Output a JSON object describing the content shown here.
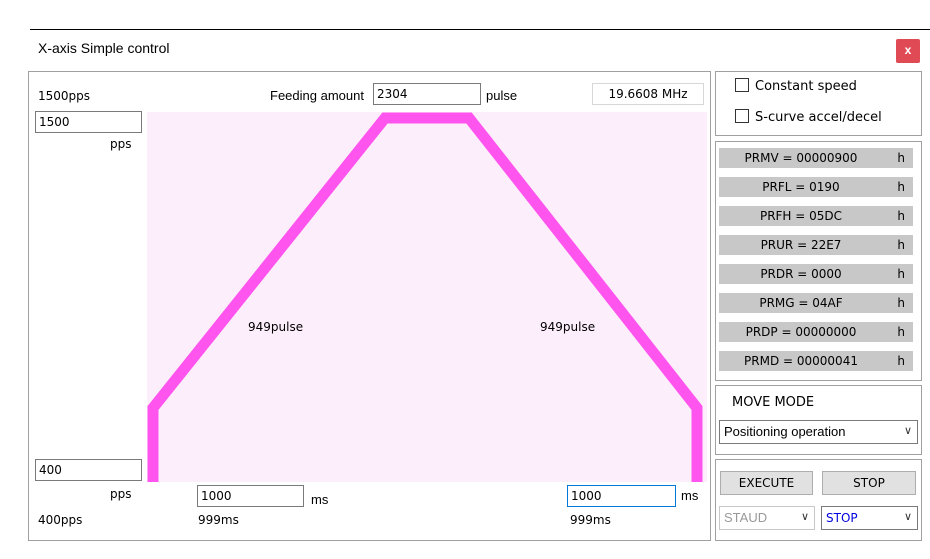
{
  "window": {
    "title": "X-axis Simple control",
    "close_label": "x"
  },
  "speed": {
    "max_label": "1500pps",
    "max_value": "1500",
    "max_unit": "pps",
    "min_value": "400",
    "min_unit": "pps",
    "min_label": "400pps"
  },
  "feed": {
    "label": "Feeding amount",
    "value": "2304",
    "unit": "pulse"
  },
  "clock": {
    "frequency": "19.6608 MHz"
  },
  "profile": {
    "accel_pulse": "949pulse",
    "decel_pulse": "949pulse",
    "accel_time_value": "1000",
    "accel_time_unit": "ms",
    "accel_time_actual": "999ms",
    "decel_time_value": "1000",
    "decel_time_unit": "ms",
    "decel_time_actual": "999ms",
    "line_color": "#ff55ee"
  },
  "options": {
    "constant_speed": "Constant speed",
    "s_curve": "S-curve accel/decel"
  },
  "registers": [
    {
      "text": "PRMV = 00000900",
      "unit": "h"
    },
    {
      "text": "PRFL = 0190",
      "unit": "h"
    },
    {
      "text": "PRFH = 05DC",
      "unit": "h"
    },
    {
      "text": "PRUR = 22E7",
      "unit": "h"
    },
    {
      "text": "PRDR = 0000",
      "unit": "h"
    },
    {
      "text": "PRMG = 04AF",
      "unit": "h"
    },
    {
      "text": "PRDP = 00000000",
      "unit": "h"
    },
    {
      "text": "PRMD = 00000041",
      "unit": "h"
    }
  ],
  "move_mode": {
    "label": "MOVE MODE",
    "selected": "Positioning operation"
  },
  "controls": {
    "execute_label": "EXECUTE",
    "stop_label": "STOP",
    "staud_select": "STAUD",
    "stop_select": "STOP"
  }
}
